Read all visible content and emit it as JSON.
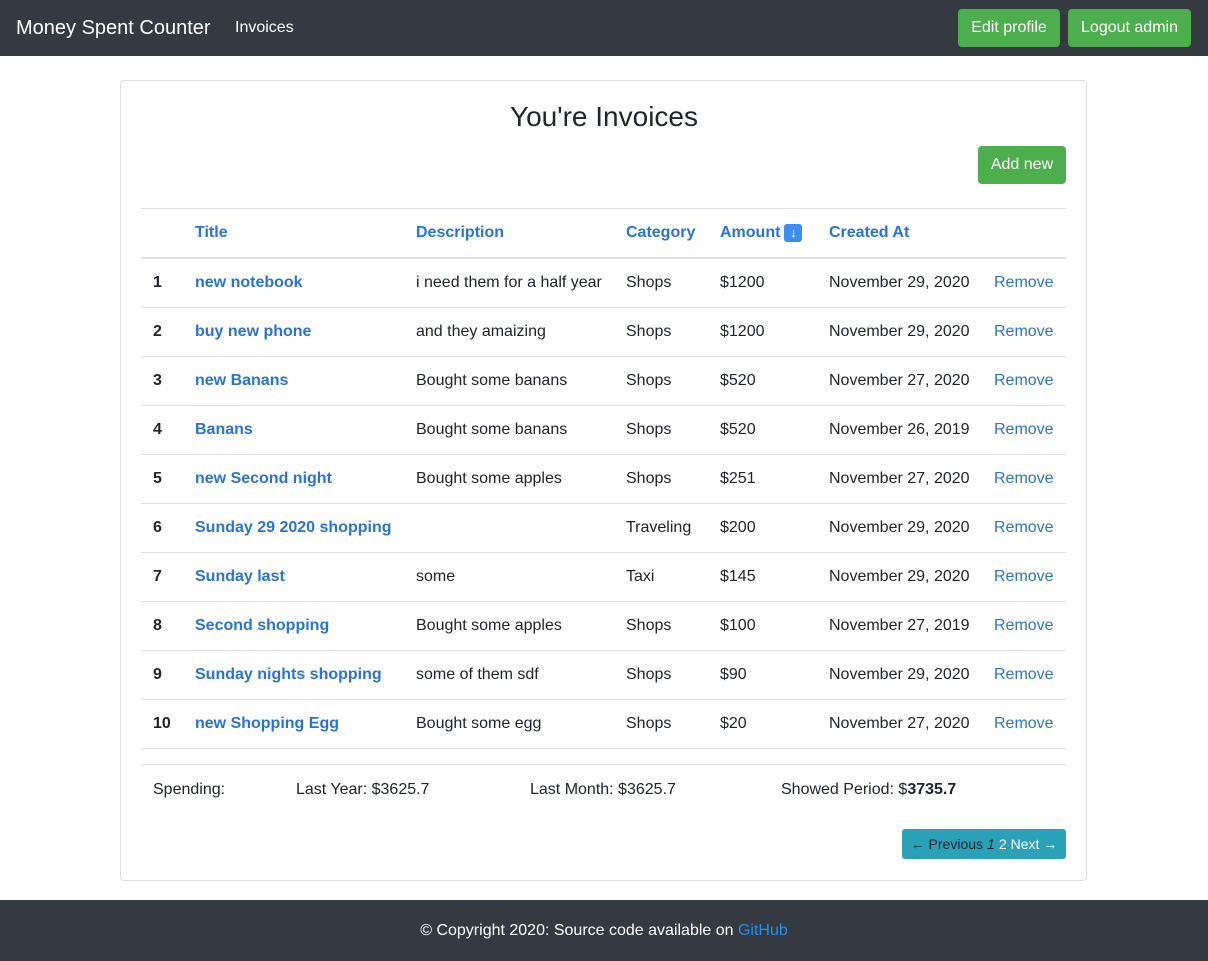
{
  "navbar": {
    "brand": "Money Spent Counter",
    "link": "Invoices",
    "edit_profile": "Edit profile",
    "logout": "Logout admin"
  },
  "page": {
    "title": "You're Invoices",
    "add_new": "Add new"
  },
  "table": {
    "headers": {
      "title": "Title",
      "description": "Description",
      "category": "Category",
      "amount": "Amount",
      "created_at": "Created At"
    },
    "sort_icon": "arrow-down-icon",
    "rows": [
      {
        "num": "1",
        "title": "new notebook",
        "description": "i need them for a half year",
        "category": "Shops",
        "amount": "$1200",
        "created_at": "November 29, 2020",
        "action": "Remove"
      },
      {
        "num": "2",
        "title": "buy new phone",
        "description": "and they amaizing",
        "category": "Shops",
        "amount": "$1200",
        "created_at": "November 29, 2020",
        "action": "Remove"
      },
      {
        "num": "3",
        "title": "new Banans",
        "description": "Bought some banans",
        "category": "Shops",
        "amount": "$520",
        "created_at": "November 27, 2020",
        "action": "Remove"
      },
      {
        "num": "4",
        "title": "Banans",
        "description": "Bought some banans",
        "category": "Shops",
        "amount": "$520",
        "created_at": "November 26, 2019",
        "action": "Remove"
      },
      {
        "num": "5",
        "title": "new Second night",
        "description": "Bought some apples",
        "category": "Shops",
        "amount": "$251",
        "created_at": "November 27, 2020",
        "action": "Remove"
      },
      {
        "num": "6",
        "title": "Sunday 29 2020 shopping",
        "description": "",
        "category": "Traveling",
        "amount": "$200",
        "created_at": "November 29, 2020",
        "action": "Remove"
      },
      {
        "num": "7",
        "title": "Sunday last",
        "description": "some",
        "category": "Taxi",
        "amount": "$145",
        "created_at": "November 29, 2020",
        "action": "Remove"
      },
      {
        "num": "8",
        "title": "Second shopping",
        "description": "Bought some apples",
        "category": "Shops",
        "amount": "$100",
        "created_at": "November 27, 2019",
        "action": "Remove"
      },
      {
        "num": "9",
        "title": "Sunday nights shopping",
        "description": "some of them sdf",
        "category": "Shops",
        "amount": "$90",
        "created_at": "November 29, 2020",
        "action": "Remove"
      },
      {
        "num": "10",
        "title": "new Shopping Egg",
        "description": "Bought some egg",
        "category": "Shops",
        "amount": "$20",
        "created_at": "November 27, 2020",
        "action": "Remove"
      }
    ]
  },
  "summary": {
    "label": "Spending:",
    "last_year": "Last Year: $3625.7",
    "last_month": "Last Month: $3625.7",
    "period_label": "Showed Period: $",
    "period_value": "3735.7"
  },
  "pagination": {
    "previous": "← Previous",
    "current": "1",
    "page2": "2",
    "next": "Next →"
  },
  "footer": {
    "text": "© Copyright 2020: Source code available on ",
    "link": "GitHub"
  }
}
